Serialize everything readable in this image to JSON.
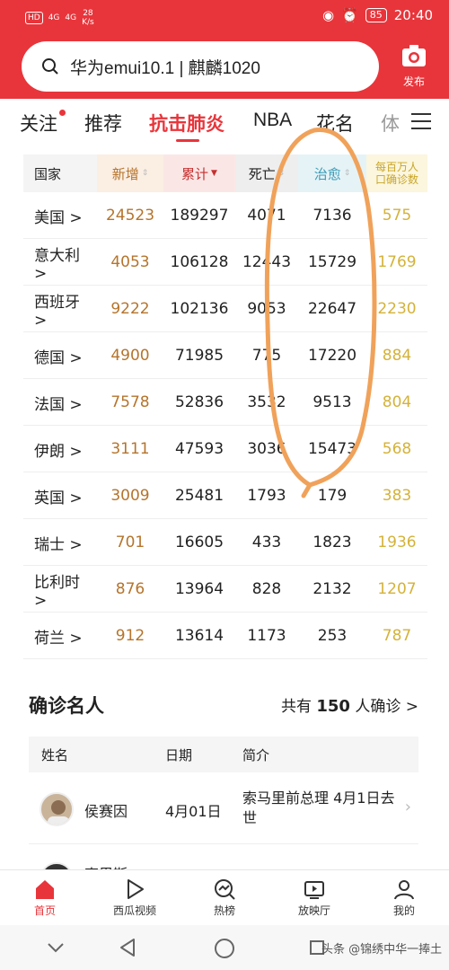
{
  "statusbar": {
    "hd": "HD",
    "signal1": "4G",
    "signal2": "4G",
    "speed_value": "28",
    "speed_unit": "K/s",
    "battery": "85",
    "time": "20:40"
  },
  "search": {
    "text": "华为emui10.1 | 麒麟1020"
  },
  "publish": {
    "label": "发布"
  },
  "tabs": [
    {
      "label": "关注"
    },
    {
      "label": "推荐"
    },
    {
      "label": "抗击肺炎"
    },
    {
      "label": "NBA"
    },
    {
      "label": "花名"
    },
    {
      "label": "体"
    }
  ],
  "table": {
    "headers": [
      "国家",
      "新增",
      "累计",
      "死亡",
      "治愈",
      "每百万人口确诊数"
    ],
    "header_ppm_line1": "每百万人",
    "header_ppm_line2": "口确诊数",
    "rows": [
      {
        "country": "美国 >",
        "new": "24523",
        "total": "189297",
        "deaths": "4071",
        "cured": "7136",
        "ppm": "575"
      },
      {
        "country": "意大利 >",
        "new": "4053",
        "total": "106128",
        "deaths": "12443",
        "cured": "15729",
        "ppm": "1769"
      },
      {
        "country": "西班牙 >",
        "new": "9222",
        "total": "102136",
        "deaths": "9053",
        "cured": "22647",
        "ppm": "2230"
      },
      {
        "country": "德国 >",
        "new": "4900",
        "total": "71985",
        "deaths": "775",
        "cured": "17220",
        "ppm": "884"
      },
      {
        "country": "法国 >",
        "new": "7578",
        "total": "52836",
        "deaths": "3532",
        "cured": "9513",
        "ppm": "804"
      },
      {
        "country": "伊朗 >",
        "new": "3111",
        "total": "47593",
        "deaths": "3036",
        "cured": "15473",
        "ppm": "568"
      },
      {
        "country": "英国 >",
        "new": "3009",
        "total": "25481",
        "deaths": "1793",
        "cured": "179",
        "ppm": "383"
      },
      {
        "country": "瑞士 >",
        "new": "701",
        "total": "16605",
        "deaths": "433",
        "cured": "1823",
        "ppm": "1936"
      },
      {
        "country": "比利时 >",
        "new": "876",
        "total": "13964",
        "deaths": "828",
        "cured": "2132",
        "ppm": "1207"
      },
      {
        "country": "荷兰 >",
        "new": "912",
        "total": "13614",
        "deaths": "1173",
        "cured": "253",
        "ppm": "787"
      }
    ]
  },
  "famous": {
    "title": "确诊名人",
    "count_prefix": "共有",
    "count_value": "150",
    "count_suffix": "人确诊 >",
    "headers": [
      "姓名",
      "日期",
      "简介"
    ],
    "rows": [
      {
        "name": "侯赛因",
        "date": "4月01日",
        "desc": "索马里前总理 4月1日去世"
      },
      {
        "name": "克里斯",
        "date": "",
        "desc": ""
      }
    ]
  },
  "bottomnav": [
    {
      "label": "首页"
    },
    {
      "label": "西瓜视频"
    },
    {
      "label": "热榜"
    },
    {
      "label": "放映厅"
    },
    {
      "label": "我的"
    }
  ],
  "watermark": "头条 @锦绣中华一捧土",
  "colors": {
    "brand_red": "#e8353b",
    "new_col": "#b5742c",
    "ppm_col": "#d4b23a",
    "annotation_orange": "#f0a25a"
  }
}
